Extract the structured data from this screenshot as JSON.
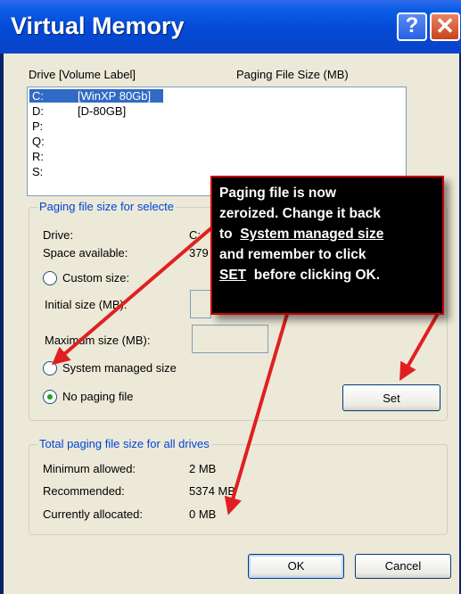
{
  "window": {
    "title": "Virtual Memory",
    "help_glyph": "?",
    "close_glyph": "✕"
  },
  "drive_list": {
    "header_drive": "Drive  [Volume Label]",
    "header_size": "Paging File Size (MB)",
    "rows": [
      {
        "letter": "C:",
        "label": "[WinXP 80Gb]",
        "selected": true
      },
      {
        "letter": "D:",
        "label": "[D-80GB]",
        "selected": false
      },
      {
        "letter": "P:",
        "label": "",
        "selected": false
      },
      {
        "letter": "Q:",
        "label": "",
        "selected": false
      },
      {
        "letter": "R:",
        "label": "",
        "selected": false
      },
      {
        "letter": "S:",
        "label": "",
        "selected": false
      }
    ]
  },
  "selected_drive_group": {
    "title": "Paging file size for selecte",
    "drive_label": "Drive:",
    "drive_value": "C:",
    "space_label": "Space available:",
    "space_value": "379",
    "custom_size_label": "Custom size:",
    "initial_size_label": "Initial size (MB):",
    "maximum_size_label": "Maximum size (MB):",
    "system_managed_label": "System managed size",
    "no_paging_label": "No paging file",
    "selected_option": "no_paging",
    "set_button": "Set"
  },
  "totals_group": {
    "title": "Total paging file size for all drives",
    "min_label": "Minimum allowed:",
    "min_value": "2 MB",
    "rec_label": "Recommended:",
    "rec_value": "5374 MB",
    "alloc_label": "Currently allocated:",
    "alloc_value": "0 MB"
  },
  "buttons": {
    "ok": "OK",
    "cancel": "Cancel"
  },
  "callout": {
    "line1": "Paging file is now",
    "line2": "zeroized.  Change it back",
    "line3_prefix": "to  ",
    "line3_link": "System managed size",
    "line4": "and remember to click",
    "line5_link": "SET",
    "line5_suffix": "  before clicking OK."
  },
  "colors": {
    "titlebar": "#0349d6",
    "dialog_bg": "#ece9d8",
    "selection": "#316ac5",
    "group_title": "#0046d5",
    "arrow": "#e02020",
    "callout_bg": "#000000"
  }
}
